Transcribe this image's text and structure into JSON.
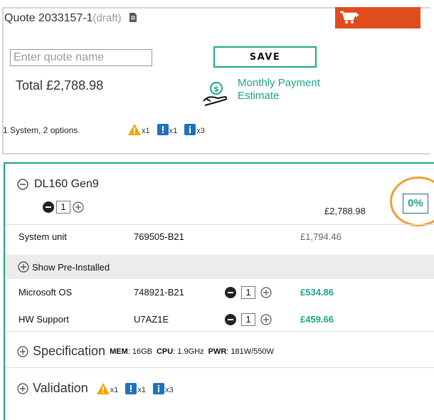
{
  "quote": {
    "title": "Quote 2033157-1",
    "status": "(draft)",
    "name_placeholder": "Enter quote name",
    "save_label": "SAVE",
    "total": "Total £2,788.98",
    "monthly_line1": "Monthly Payment",
    "monthly_line2": "Estimate",
    "summary": "1 System, 2 options",
    "alerts": [
      {
        "icon": "warning-icon",
        "count": "x1",
        "color": "#f5a300"
      },
      {
        "icon": "error-icon",
        "count": "x1",
        "color": "#1e73be"
      },
      {
        "icon": "info-icon",
        "count": "x3",
        "color": "#1e73be"
      }
    ],
    "cart_icon": "cart-add-icon",
    "monthly_icon": "hand-coin-icon"
  },
  "system": {
    "name": "DL160 Gen9",
    "qty": "1",
    "price": "£2,788.98",
    "discount": "0%",
    "unit": {
      "label": "System unit",
      "part": "769505-B21",
      "price": "£1,794.46"
    },
    "show_preinstalled": "Show Pre-Installed",
    "options": [
      {
        "label": "Microsoft OS",
        "part": "748921-B21",
        "qty": "1",
        "price": "£534.86"
      },
      {
        "label": "HW Support",
        "part": "U7AZ1E",
        "qty": "1",
        "price": "£459.66"
      }
    ],
    "spec": {
      "label": "Specification",
      "mem_label": "MEM",
      "mem_value": ": 16GB",
      "cpu_label": "CPU",
      "cpu_value": ": 1.9GHz",
      "pwr_label": "PWR",
      "pwr_value": ": 181W/550W"
    },
    "validation": {
      "label": "Validation",
      "alerts": [
        {
          "icon": "warning-icon",
          "count": "x1"
        },
        {
          "icon": "error-icon",
          "count": "x1"
        },
        {
          "icon": "info-icon",
          "count": "x3"
        }
      ]
    }
  },
  "colors": {
    "accent": "#1aa785",
    "cart": "#e04c1c",
    "warning": "#f5a300",
    "info": "#1e73be",
    "highlight_ring": "#f0a030"
  }
}
